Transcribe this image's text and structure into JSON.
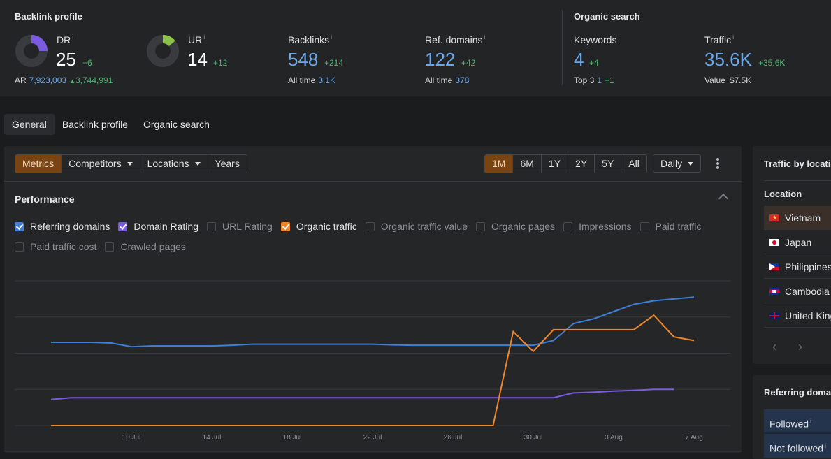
{
  "backlink_profile": {
    "title": "Backlink profile",
    "dr": {
      "label": "DR",
      "value": "25",
      "delta": "+6",
      "gauge_fraction": 0.25,
      "color": "#7b5ce0"
    },
    "ur": {
      "label": "UR",
      "value": "14",
      "delta": "+12",
      "gauge_fraction": 0.14,
      "color": "#8bc34a"
    },
    "ar": {
      "label": "AR",
      "value": "7,923,003",
      "delta": "3,744,991"
    },
    "backlinks": {
      "label": "Backlinks",
      "value": "548",
      "delta": "+214",
      "sub_label": "All time",
      "sub_value": "3.1K"
    },
    "ref_domains": {
      "label": "Ref. domains",
      "value": "122",
      "delta": "+42",
      "sub_label": "All time",
      "sub_value": "378"
    }
  },
  "organic_search": {
    "title": "Organic search",
    "keywords": {
      "label": "Keywords",
      "value": "4",
      "delta": "+4",
      "sub_label": "Top 3",
      "sub_value": "1",
      "sub_delta": "+1"
    },
    "traffic": {
      "label": "Traffic",
      "value": "35.6K",
      "delta": "+35.6K",
      "sub_label": "Value",
      "sub_value": "$7.5K"
    }
  },
  "info_glyph": "i",
  "tabs": [
    {
      "label": "General",
      "active": true
    },
    {
      "label": "Backlink profile",
      "active": false
    },
    {
      "label": "Organic search",
      "active": false
    }
  ],
  "toolbar": {
    "views": [
      {
        "label": "Metrics",
        "active": true,
        "dropdown": false
      },
      {
        "label": "Competitors",
        "active": false,
        "dropdown": true
      },
      {
        "label": "Locations",
        "active": false,
        "dropdown": true
      },
      {
        "label": "Years",
        "active": false,
        "dropdown": false
      }
    ],
    "ranges": [
      {
        "label": "1M",
        "active": true
      },
      {
        "label": "6M",
        "active": false
      },
      {
        "label": "1Y",
        "active": false
      },
      {
        "label": "2Y",
        "active": false
      },
      {
        "label": "5Y",
        "active": false
      },
      {
        "label": "All",
        "active": false
      }
    ],
    "interval": "Daily"
  },
  "performance": {
    "title": "Performance",
    "metrics_row1": [
      {
        "label": "Referring domains",
        "checked": true,
        "color": "#3f7fd6"
      },
      {
        "label": "Domain Rating",
        "checked": true,
        "color": "#7b5ce0"
      },
      {
        "label": "URL Rating",
        "checked": false
      },
      {
        "label": "Organic traffic",
        "checked": true,
        "color": "#f0862c"
      },
      {
        "label": "Organic traffic value",
        "checked": false
      },
      {
        "label": "Organic pages",
        "checked": false
      },
      {
        "label": "Impressions",
        "checked": false
      },
      {
        "label": "Paid traffic",
        "checked": false
      }
    ],
    "metrics_row2": [
      {
        "label": "Paid traffic cost",
        "checked": false
      },
      {
        "label": "Crawled pages",
        "checked": false
      }
    ]
  },
  "chart_data": {
    "type": "line",
    "title": "Performance",
    "x": [
      "6 Jul",
      "7 Jul",
      "8 Jul",
      "9 Jul",
      "10 Jul",
      "11 Jul",
      "12 Jul",
      "13 Jul",
      "14 Jul",
      "15 Jul",
      "16 Jul",
      "17 Jul",
      "18 Jul",
      "19 Jul",
      "20 Jul",
      "21 Jul",
      "22 Jul",
      "23 Jul",
      "24 Jul",
      "25 Jul",
      "26 Jul",
      "27 Jul",
      "28 Jul",
      "29 Jul",
      "30 Jul",
      "31 Jul",
      "1 Aug",
      "2 Aug",
      "3 Aug",
      "4 Aug",
      "5 Aug",
      "6 Aug",
      "7 Aug"
    ],
    "x_ticks": [
      "10 Jul",
      "14 Jul",
      "18 Jul",
      "22 Jul",
      "26 Jul",
      "30 Jul",
      "3 Aug",
      "7 Aug"
    ],
    "grid": true,
    "y_normalized_range": [
      0,
      4
    ],
    "series": [
      {
        "name": "Referring domains",
        "color": "#3f7fd6",
        "values": [
          2.3,
          2.3,
          2.3,
          2.28,
          2.18,
          2.2,
          2.2,
          2.2,
          2.2,
          2.22,
          2.25,
          2.25,
          2.25,
          2.25,
          2.25,
          2.25,
          2.25,
          2.23,
          2.22,
          2.22,
          2.22,
          2.22,
          2.22,
          2.22,
          2.22,
          2.35,
          2.82,
          2.95,
          3.15,
          3.35,
          3.45,
          3.5,
          3.55
        ]
      },
      {
        "name": "Domain Rating",
        "color": "#7b5ce0",
        "values": [
          0.72,
          0.77,
          0.77,
          0.77,
          0.77,
          0.77,
          0.77,
          0.77,
          0.77,
          0.77,
          0.77,
          0.77,
          0.77,
          0.77,
          0.77,
          0.77,
          0.77,
          0.77,
          0.77,
          0.77,
          0.77,
          0.77,
          0.77,
          0.77,
          0.77,
          0.77,
          0.9,
          0.92,
          0.95,
          0.97,
          1.0,
          1.0,
          null
        ]
      },
      {
        "name": "Organic traffic",
        "color": "#f0862c",
        "values": [
          0,
          0,
          0,
          0,
          0,
          0,
          0,
          0,
          0,
          0,
          0,
          0,
          0,
          0,
          0,
          0,
          0,
          0,
          0,
          0,
          0,
          0,
          0,
          2.6,
          2.05,
          2.65,
          2.65,
          2.65,
          2.65,
          2.65,
          3.05,
          2.45,
          2.35
        ]
      }
    ]
  },
  "traffic_by_location": {
    "title": "Traffic by location",
    "column": "Location",
    "rows": [
      {
        "country": "Vietnam",
        "highlighted": true
      },
      {
        "country": "Japan",
        "highlighted": false
      },
      {
        "country": "Philippines",
        "highlighted": false
      },
      {
        "country": "Cambodia",
        "highlighted": false
      },
      {
        "country": "United Kingdom",
        "highlighted": false
      }
    ],
    "prev": "‹",
    "next": "›"
  },
  "referring_domains": {
    "title": "Referring domains",
    "rows": [
      {
        "label": "Followed"
      },
      {
        "label": "Not followed"
      }
    ]
  }
}
